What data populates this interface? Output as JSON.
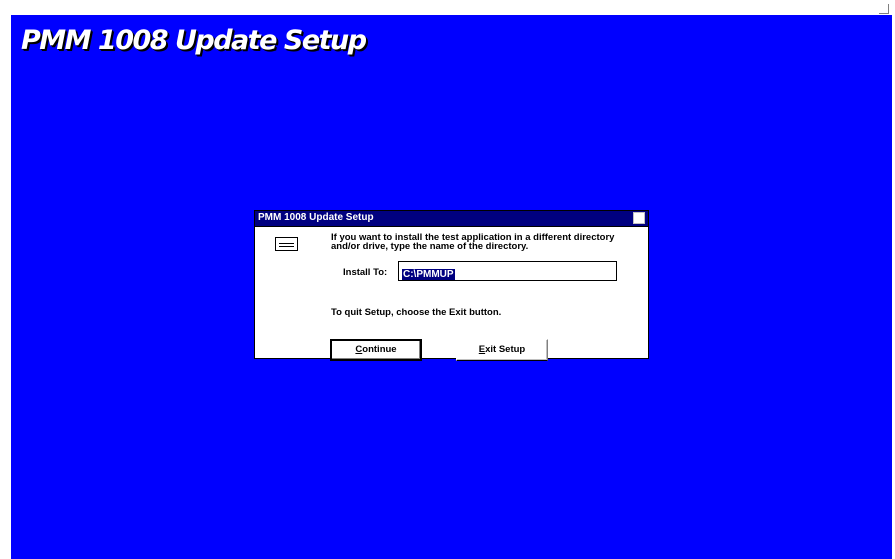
{
  "window": {
    "title": "PMM 1008 Update Setup",
    "background_color": "#0000ff"
  },
  "dialog": {
    "title": "PMM 1008 Update Setup",
    "titlebar_color": "#000080",
    "icon": "disk-drive-icon",
    "instruction": "If you want to install the test application in a different directory\nand/or drive, type the name of the directory.",
    "install_label": "Install To:",
    "install_value": "C:\\PMMUP",
    "quit_note": "To quit Setup, choose the Exit button.",
    "continue_label": "Continue",
    "exit_label": "Exit Setup"
  }
}
